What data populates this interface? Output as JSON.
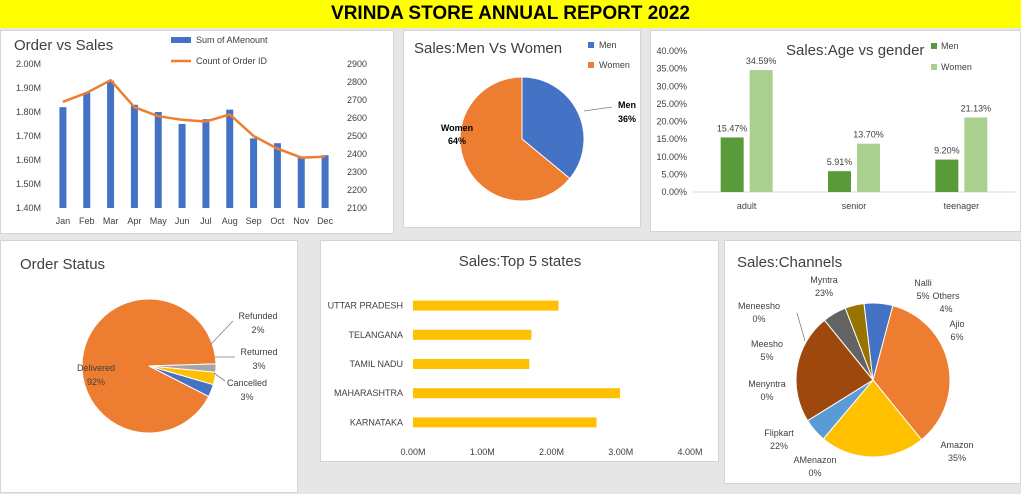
{
  "report": {
    "title": "VRINDA STORE ANNUAL REPORT 2022"
  },
  "colors": {
    "banner": "#ffff00",
    "blue": "#4472c4",
    "orange": "#ed7d31",
    "gold": "#ffc000",
    "green_dark": "#5b9a3a",
    "green_light": "#a9d08e",
    "grey": "#a5a5a5"
  },
  "chart_data": [
    {
      "id": "order-vs-sales",
      "type": "bar",
      "title": "Order vs Sales",
      "categories": [
        "Jan",
        "Feb",
        "Mar",
        "Apr",
        "May",
        "Jun",
        "Jul",
        "Aug",
        "Sep",
        "Oct",
        "Nov",
        "Dec"
      ],
      "series": [
        {
          "name": "Sum of AMenount",
          "type": "bar",
          "axis": "left",
          "values": [
            1.82,
            1.88,
            1.93,
            1.83,
            1.8,
            1.75,
            1.77,
            1.81,
            1.69,
            1.67,
            1.61,
            1.62
          ]
        },
        {
          "name": "Count of Order ID",
          "type": "line",
          "axis": "right",
          "values": [
            2690,
            2740,
            2810,
            2660,
            2610,
            2590,
            2580,
            2620,
            2500,
            2430,
            2380,
            2385
          ]
        }
      ],
      "ylim_left": [
        1.4,
        2.0
      ],
      "yticks_left": [
        "1.40M",
        "1.50M",
        "1.60M",
        "1.70M",
        "1.80M",
        "1.90M",
        "2.00M"
      ],
      "ylim_right": [
        2100,
        2900
      ],
      "yticks_right": [
        "2100",
        "2200",
        "2300",
        "2400",
        "2500",
        "2600",
        "2700",
        "2800",
        "2900"
      ],
      "legend": "top"
    },
    {
      "id": "men-vs-women",
      "type": "pie",
      "title": "Sales:Men Vs Women",
      "slices": [
        {
          "label": "Men",
          "value": 36,
          "pct_label": "36%"
        },
        {
          "label": "Women",
          "value": 64,
          "pct_label": "64%"
        }
      ],
      "legend": "top-right"
    },
    {
      "id": "age-vs-gender",
      "type": "bar",
      "title": "Sales:Age vs gender",
      "categories": [
        "adult",
        "senior",
        "teenager"
      ],
      "series": [
        {
          "name": "Men",
          "values": [
            15.47,
            5.91,
            9.2
          ],
          "labels": [
            "15.47%",
            "5.91%",
            "9.20%"
          ]
        },
        {
          "name": "Women",
          "values": [
            34.59,
            13.7,
            21.13
          ],
          "labels": [
            "34.59%",
            "13.70%",
            "21.13%"
          ]
        }
      ],
      "ylim": [
        0,
        40
      ],
      "yticks": [
        "0.00%",
        "5.00%",
        "10.00%",
        "15.00%",
        "20.00%",
        "25.00%",
        "30.00%",
        "35.00%",
        "40.00%"
      ],
      "legend": "top-right"
    },
    {
      "id": "order-status",
      "type": "pie",
      "title": "Order Status",
      "slices": [
        {
          "label": "Delivered",
          "value": 92,
          "pct_label": "92%"
        },
        {
          "label": "Refunded",
          "value": 2,
          "pct_label": "2%"
        },
        {
          "label": "Returned",
          "value": 3,
          "pct_label": "3%"
        },
        {
          "label": "Cancelled",
          "value": 3,
          "pct_label": "3%"
        }
      ]
    },
    {
      "id": "top-5-states",
      "type": "bar",
      "orientation": "horizontal",
      "title": "Sales:Top 5 states",
      "categories": [
        "UTTAR PRADESH",
        "TELANGANA",
        "TAMIL NADU",
        "MAHARASHTRA",
        "KARNATAKA"
      ],
      "values": [
        2.1,
        1.71,
        1.68,
        2.99,
        2.65
      ],
      "xlim": [
        0,
        4
      ],
      "xticks": [
        "0.00M",
        "1.00M",
        "2.00M",
        "3.00M",
        "4.00M"
      ]
    },
    {
      "id": "sales-channels",
      "type": "pie",
      "title": "Sales:Channels",
      "slices": [
        {
          "label": "Amazon",
          "value": 35,
          "pct_label": "35%"
        },
        {
          "label": "AMenazon",
          "value": 0,
          "pct_label": "0%"
        },
        {
          "label": "Flipkart",
          "value": 22,
          "pct_label": "22%"
        },
        {
          "label": "Menyntra",
          "value": 0,
          "pct_label": "0%"
        },
        {
          "label": "Meesho",
          "value": 5,
          "pct_label": "5%"
        },
        {
          "label": "Meneesho",
          "value": 0,
          "pct_label": "0%"
        },
        {
          "label": "Myntra",
          "value": 23,
          "pct_label": "23%"
        },
        {
          "label": "Nalli",
          "value": 5,
          "pct_label": "5%"
        },
        {
          "label": "Others",
          "value": 4,
          "pct_label": "4%"
        },
        {
          "label": "Ajio",
          "value": 6,
          "pct_label": "6%"
        }
      ]
    }
  ]
}
